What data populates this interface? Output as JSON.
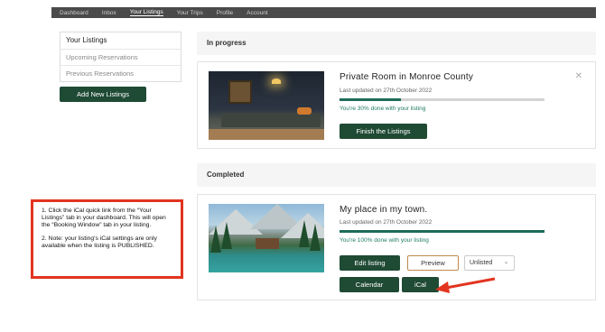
{
  "nav": {
    "items": [
      "Dashboard",
      "Inbox",
      "Your Listings",
      "Your Trips",
      "Profile",
      "Account"
    ],
    "active_index": 2
  },
  "sidebar": {
    "items": [
      "Your Listings",
      "Upcoming Reservations",
      "Previous Reservations"
    ],
    "add_button": "Add New Listings"
  },
  "in_progress": {
    "heading": "In progress",
    "listing": {
      "title": "Private Room in Monroe County",
      "updated": "Last updated on 27th October 2022",
      "progress_fraction": 0.3,
      "progress_text": "You're 30% done with your listing",
      "finish_button": "Finish the Listings",
      "close_glyph": "✕"
    }
  },
  "completed": {
    "heading": "Completed",
    "listing": {
      "title": "My place in my town.",
      "updated": "Last updated on 27th October 2022",
      "progress_fraction": 1.0,
      "progress_text": "You're 100% done with your listing",
      "edit_button": "Edit listing",
      "preview_button": "Preview",
      "status_select": "Unlisted",
      "calendar_button": "Calendar",
      "ical_button": "iCal"
    }
  },
  "callout": {
    "note1": "1. Click the iCal quick link from the “Your Listings” tab in your dashboard. This will open the “Booking Window” tab in your listing.",
    "note2": "2. Note: your listing's iCal settings are only available when the listing is PUBLISHED."
  },
  "colors": {
    "brand_green": "#1f4a34",
    "progress_green": "#1f6b5a",
    "callout_red": "#e2341f"
  }
}
